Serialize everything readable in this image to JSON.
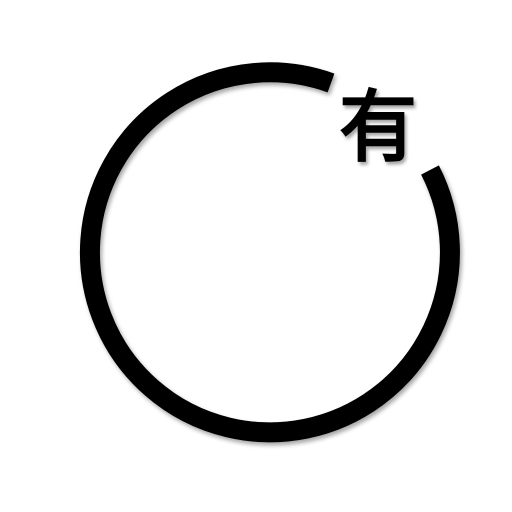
{
  "logo": {
    "character": "有",
    "ring_color": "#000000",
    "text_color": "#000000",
    "background_color": "#ffffff"
  }
}
